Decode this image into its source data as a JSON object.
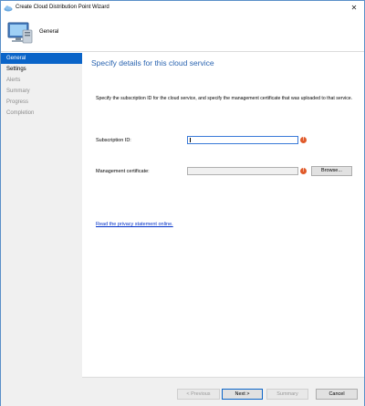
{
  "window": {
    "title": "Create Cloud Distribution Point Wizard",
    "close_glyph": "✕"
  },
  "header": {
    "icon": "computer-icon",
    "title": "General"
  },
  "sidebar": {
    "items": [
      {
        "label": "General",
        "state": "active"
      },
      {
        "label": "Settings",
        "state": "done"
      },
      {
        "label": "Alerts",
        "state": "pending"
      },
      {
        "label": "Summary",
        "state": "pending"
      },
      {
        "label": "Progress",
        "state": "pending"
      },
      {
        "label": "Completion",
        "state": "pending"
      }
    ]
  },
  "main": {
    "heading": "Specify details for this cloud service",
    "description": "Specify the subscription ID for the cloud service, and specify the management certificate that was uploaded to that service.",
    "subscription": {
      "label": "Subscription ID:",
      "value": ""
    },
    "certificate": {
      "label": "Management certificate:",
      "value": "",
      "browse_label": "Browse..."
    },
    "error_glyph": "!",
    "privacy_link": "Read the privacy statement online."
  },
  "footer": {
    "previous_label": "< Previous",
    "next_label": "Next >",
    "summary_label": "Summary",
    "cancel_label": "Cancel"
  },
  "colors": {
    "accent": "#0a64c8",
    "heading": "#2a64b0",
    "error": "#e05a2a",
    "link": "#0030c8"
  }
}
